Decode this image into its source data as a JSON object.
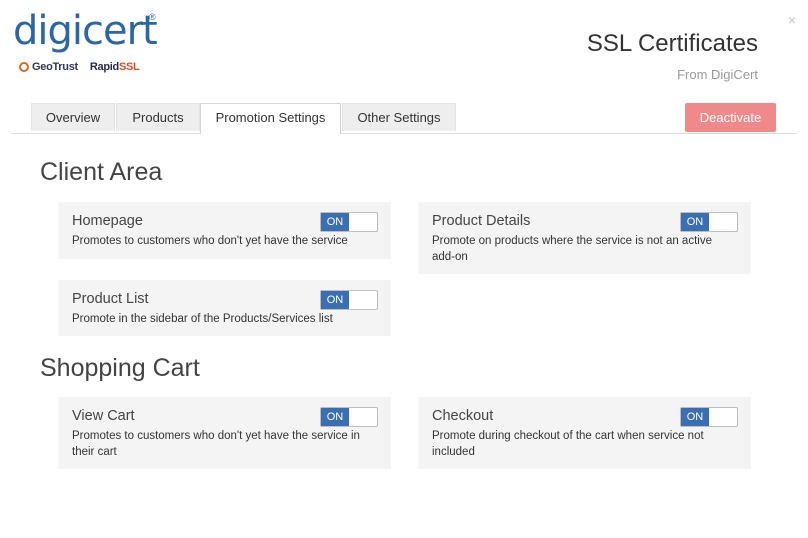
{
  "header": {
    "logo_text": "digicert",
    "logo_reg": "®",
    "brand_geotrust": "GeoTrust",
    "brand_rapid": "Rapid",
    "brand_ssl": "SSL",
    "title": "SSL Certificates",
    "subtitle": "From DigiCert",
    "close_symbol": "×"
  },
  "tabs": [
    {
      "label": "Overview",
      "active": false
    },
    {
      "label": "Products",
      "active": false
    },
    {
      "label": "Promotion Settings",
      "active": true
    },
    {
      "label": "Other Settings",
      "active": false
    }
  ],
  "deactivate_label": "Deactivate",
  "sections": {
    "client_area": {
      "title": "Client Area",
      "cards": [
        {
          "title": "Homepage",
          "description": "Promotes to customers who don't yet have the service",
          "toggle": "ON"
        },
        {
          "title": "Product Details",
          "description": "Promote on products where the service is not an active add-on",
          "toggle": "ON"
        },
        {
          "title": "Product List",
          "description": "Promote in the sidebar of the Products/Services list",
          "toggle": "ON"
        }
      ]
    },
    "shopping_cart": {
      "title": "Shopping Cart",
      "cards": [
        {
          "title": "View Cart",
          "description": "Promotes to customers who don't yet have the service in their cart",
          "toggle": "ON"
        },
        {
          "title": "Checkout",
          "description": "Promote during checkout of the cart when service not included",
          "toggle": "ON"
        }
      ]
    }
  },
  "colors": {
    "brand_blue": "#2c67a5",
    "toggle_on": "#3b6fb3",
    "deactivate": "#f08a8a"
  }
}
